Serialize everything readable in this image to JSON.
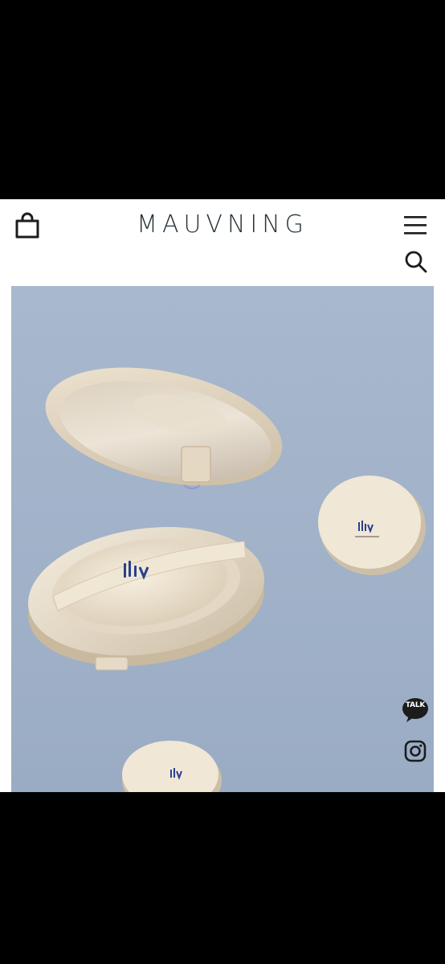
{
  "header": {
    "brand": "MAUVNING",
    "cart_icon": "shopping-bag-icon",
    "menu_icon": "hamburger-menu-icon",
    "search_icon": "search-icon"
  },
  "hero": {
    "product_mark": "Mv",
    "image": "cushion-compact-product-photo"
  },
  "floating": {
    "talk_label": "TALK",
    "talk_icon": "kakao-talk-chat-icon",
    "instagram_icon": "instagram-icon"
  },
  "colors": {
    "brand_text": "#26323a",
    "hero_background": "#a3b3c9",
    "compact": "#e7dcc9",
    "mark_blue": "#2a3f8f"
  }
}
